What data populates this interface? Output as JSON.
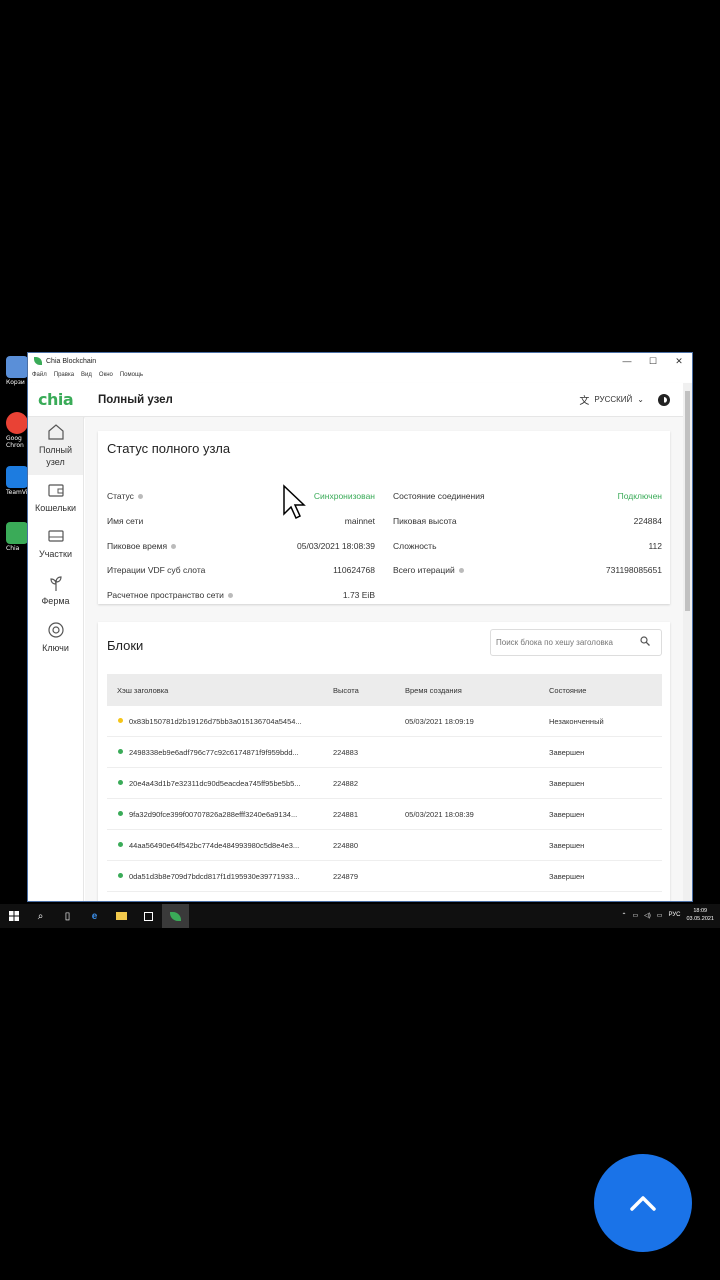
{
  "desktop_icons": [
    {
      "label": "Корзи",
      "color": "#5a8fd8"
    },
    {
      "label": "Goog Chron",
      "color": "#e94235"
    },
    {
      "label": "TeamVi",
      "color": "#1d7ce0"
    },
    {
      "label": "Chia",
      "color": "#3aab58"
    }
  ],
  "window": {
    "title": "Chia Blockchain",
    "menu": [
      "Файл",
      "Правка",
      "Вид",
      "Окно",
      "Помощь"
    ],
    "controls": {
      "minimize": "—",
      "maximize": "☐",
      "close": "✕"
    }
  },
  "appbar": {
    "logo": "chia",
    "title": "Полный узел",
    "language": "РУССКИЙ"
  },
  "sidebar": {
    "items": [
      {
        "label": "Полный узел",
        "icon": "home-icon"
      },
      {
        "label": "Кошельки",
        "icon": "wallet-icon"
      },
      {
        "label": "Участки",
        "icon": "storage-icon"
      },
      {
        "label": "Ферма",
        "icon": "sprout-icon"
      },
      {
        "label": "Ключи",
        "icon": "lifebuoy-icon"
      }
    ]
  },
  "status": {
    "title": "Статус полного узла",
    "left": [
      {
        "label": "Статус",
        "value": "Синхронизован"
      },
      {
        "label": "Имя сети",
        "value": "mainnet"
      },
      {
        "label": "Пиковое время",
        "value": "05/03/2021 18:08:39"
      },
      {
        "label": "Итерации VDF суб слота",
        "value": "110624768"
      },
      {
        "label": "Расчетное пространство сети",
        "value": "1.73 EiB"
      }
    ],
    "right": [
      {
        "label": "Состояние соединения",
        "value": "Подключен"
      },
      {
        "label": "Пиковая высота",
        "value": "224884"
      },
      {
        "label": "Сложность",
        "value": "112"
      },
      {
        "label": "Всего итераций",
        "value": "731198085651"
      }
    ]
  },
  "blocks": {
    "title": "Блоки",
    "search_placeholder": "Поиск блока по хешу заголовка",
    "columns": [
      "Хэш заголовка",
      "Высота",
      "Время создания",
      "Состояние"
    ],
    "rows": [
      {
        "hash": "0x83b150781d2b19126d75bb3a015136704a5454...",
        "height": "",
        "time": "05/03/2021 18:09:19",
        "state": "Незаконченный",
        "dot": "#f5c518"
      },
      {
        "hash": "2498338eb9e6adf796c77c92c6174871f9f959bdd...",
        "height": "224883",
        "time": "",
        "state": "Завершен",
        "dot": "#3aab58"
      },
      {
        "hash": "20e4a43d1b7e32311dc90d5eacdea745ff95be5b5...",
        "height": "224882",
        "time": "",
        "state": "Завершен",
        "dot": "#3aab58"
      },
      {
        "hash": "9fa32d90fce399f00707826a288efff3240e6a9134...",
        "height": "224881",
        "time": "05/03/2021 18:08:39",
        "state": "Завершен",
        "dot": "#3aab58"
      },
      {
        "hash": "44aa56490e64f542bc774de484993980c5d8e4e3...",
        "height": "224880",
        "time": "",
        "state": "Завершен",
        "dot": "#3aab58"
      },
      {
        "hash": "0da51d3b8e709d7bdcd817f1d195930e39771933...",
        "height": "224879",
        "time": "",
        "state": "Завершен",
        "dot": "#3aab58"
      }
    ]
  },
  "taskbar": {
    "lang": "РУС",
    "time": "18:09",
    "date": "03.05.2021"
  }
}
